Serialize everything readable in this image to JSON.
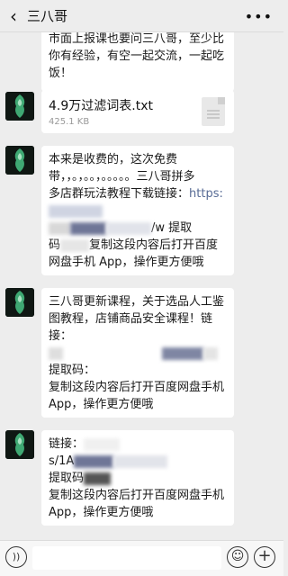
{
  "header": {
    "title": "三八哥",
    "back_icon": "chevron-left-icon",
    "more_icon": "ellipsis-icon"
  },
  "messages": [
    {
      "lines": [
        "市面上报课也要问三八哥，至少比",
        "你有经验，有空一起交流，一起吃",
        "饭！"
      ]
    },
    {
      "file_name": "4.9万过滤词表.txt",
      "file_size": "425.1 KB"
    },
    {
      "line1": "本来是收费的，这次免费",
      "line2": "带，，。，。。，。。。。。三八哥拼多",
      "line3": "多店群玩法教程下载链接：",
      "link": "https:",
      "line5_tail": "/w 提取",
      "line6_head": "码",
      "line6_tail": "复制这段内容后打开百度",
      "line7": "网盘手机 App，操作更方便哦"
    },
    {
      "line1": "三八哥更新课程，关于选品人工鉴",
      "line2": "图教程，店铺商品安全课程！链接：",
      "line4": "提取码：",
      "line5": "复制这段内容后打开百度网盘手机",
      "line6": "App，操作更方便哦"
    },
    {
      "line1": "链接：",
      "line2": "s/1A",
      "line3": "提取码",
      "line4": "复制这段内容后打开百度网盘手机",
      "line5": "App，操作更方便哦"
    }
  ],
  "inputbar": {
    "voice_icon": "voice-icon",
    "emoji_icon": "emoji-icon",
    "plus_icon": "plus-icon"
  }
}
